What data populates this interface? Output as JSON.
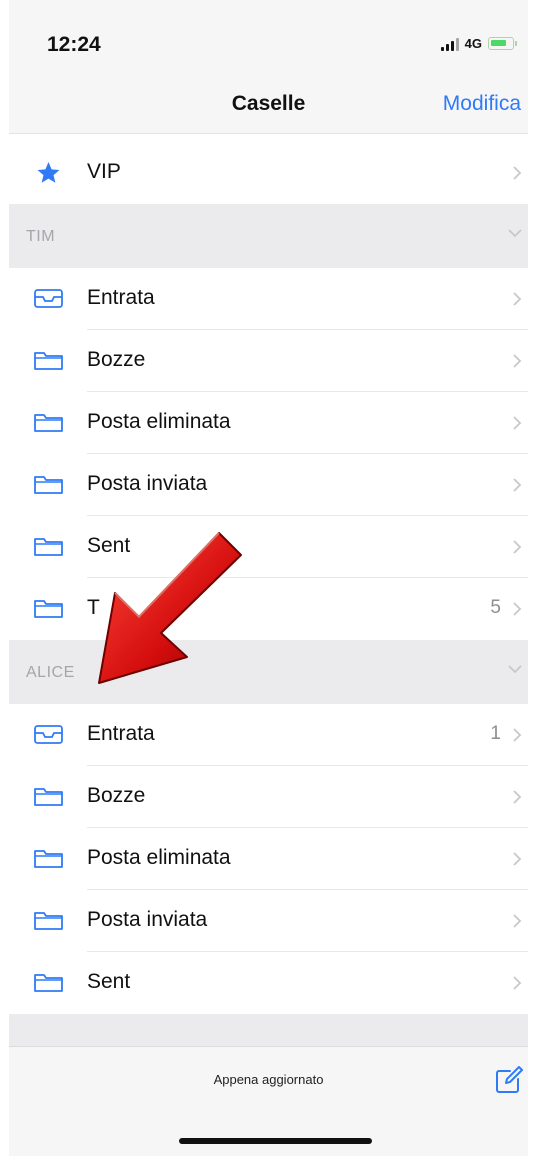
{
  "status_bar": {
    "time": "12:24",
    "network": "4G"
  },
  "nav": {
    "title": "Caselle",
    "edit_label": "Modifica"
  },
  "vip": {
    "label": "VIP",
    "icon": "star-icon"
  },
  "accounts": [
    {
      "name": "TIM",
      "folders": [
        {
          "label": "Entrata",
          "icon": "inbox-icon",
          "count": ""
        },
        {
          "label": "Bozze",
          "icon": "folder-icon",
          "count": ""
        },
        {
          "label": "Posta eliminata",
          "icon": "folder-icon",
          "count": ""
        },
        {
          "label": "Posta inviata",
          "icon": "folder-icon",
          "count": ""
        },
        {
          "label": "Sent",
          "icon": "folder-icon",
          "count": ""
        },
        {
          "label": "T",
          "icon": "folder-icon",
          "count": "5"
        }
      ]
    },
    {
      "name": "ALICE",
      "folders": [
        {
          "label": "Entrata",
          "icon": "inbox-icon",
          "count": "1"
        },
        {
          "label": "Bozze",
          "icon": "folder-icon",
          "count": ""
        },
        {
          "label": "Posta eliminata",
          "icon": "folder-icon",
          "count": ""
        },
        {
          "label": "Posta inviata",
          "icon": "folder-icon",
          "count": ""
        },
        {
          "label": "Sent",
          "icon": "folder-icon",
          "count": ""
        }
      ]
    }
  ],
  "toolbar": {
    "status": "Appena aggiornato",
    "compose_icon": "compose-icon"
  },
  "colors": {
    "accent": "#2f7bf6",
    "arrow": "#d40d0d"
  }
}
